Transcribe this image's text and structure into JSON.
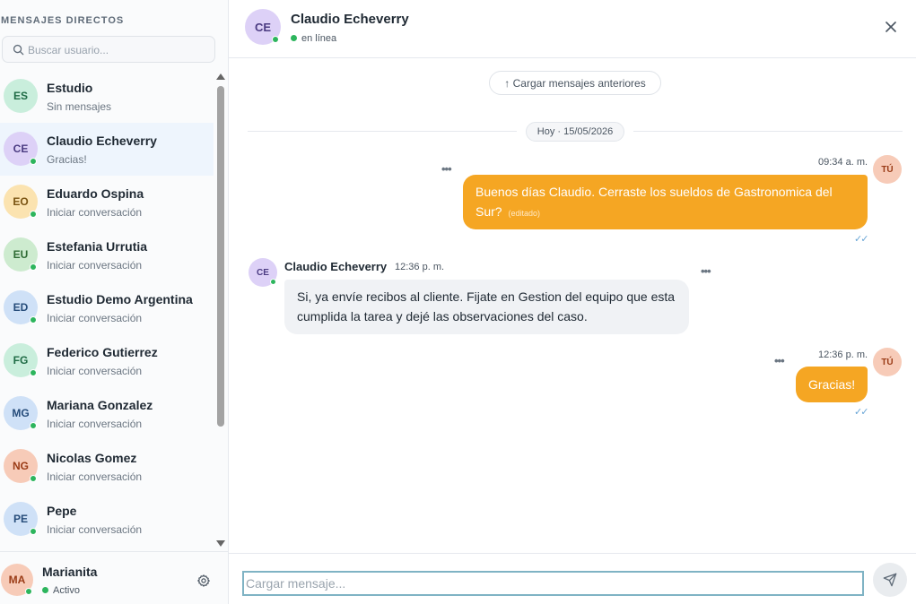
{
  "sidebar": {
    "title": "MENSAJES DIRECTOS",
    "search_placeholder": "Buscar usuario...",
    "contacts": [
      {
        "initials": "ES",
        "name": "Estudio",
        "sub": "Sin mensajes",
        "bg": "#c9eedc",
        "fg": "#1f6b45",
        "online": false,
        "active": false
      },
      {
        "initials": "CE",
        "name": "Claudio Echeverry",
        "sub": "Gracias!",
        "bg": "#ddd1f7",
        "fg": "#4b3b82",
        "online": true,
        "active": true
      },
      {
        "initials": "EO",
        "name": "Eduardo Ospina",
        "sub": "Iniciar conversación",
        "bg": "#fbe3b0",
        "fg": "#7a5412",
        "online": true,
        "active": false
      },
      {
        "initials": "EU",
        "name": "Estefania Urrutia",
        "sub": "Iniciar conversación",
        "bg": "#cdebcf",
        "fg": "#2f6b34",
        "online": true,
        "active": false
      },
      {
        "initials": "ED",
        "name": "Estudio Demo Argentina",
        "sub": "Iniciar conversación",
        "bg": "#cfe1f7",
        "fg": "#264c7a",
        "online": true,
        "active": false
      },
      {
        "initials": "FG",
        "name": "Federico Gutierrez",
        "sub": "Iniciar conversación",
        "bg": "#c9eedc",
        "fg": "#1f6b45",
        "online": true,
        "active": false
      },
      {
        "initials": "MG",
        "name": "Mariana Gonzalez",
        "sub": "Iniciar conversación",
        "bg": "#cfe1f7",
        "fg": "#264c7a",
        "online": true,
        "active": false
      },
      {
        "initials": "NG",
        "name": "Nicolas Gomez",
        "sub": "Iniciar conversación",
        "bg": "#f7cbb8",
        "fg": "#9a3b16",
        "online": true,
        "active": false
      },
      {
        "initials": "PE",
        "name": "Pepe",
        "sub": "Iniciar conversación",
        "bg": "#cfe1f7",
        "fg": "#264c7a",
        "online": true,
        "active": false
      }
    ],
    "me": {
      "initials": "MA",
      "name": "Marianita",
      "status": "Activo"
    }
  },
  "chat": {
    "header": {
      "initials": "CE",
      "name": "Claudio Echeverry",
      "status": "en línea"
    },
    "load_more": "↑ Cargar mensajes anteriores",
    "date_label": "Hoy · 15/05/2026",
    "me_initials": "TÚ",
    "messages": [
      {
        "time": "09:34 a. m.",
        "line1": "Buenos días Claudio. Cerraste los sueldos de Gastronomica del",
        "line2": "Sur?",
        "edited": "(editado)",
        "ticks": "✓✓"
      },
      {
        "sender": "Claudio Echeverry",
        "initials": "CE",
        "time": "12:36 p. m.",
        "line1": "Si, ya envíe recibos al cliente. Fijate en Gestion del equipo que esta",
        "line2": "cumplida la tarea y dejé las observaciones del caso."
      },
      {
        "time": "12:36 p. m.",
        "text": "Gracias!",
        "ticks": "✓✓"
      }
    ],
    "more_glyph": "•••",
    "input_placeholder": "Cargar mensaje..."
  }
}
